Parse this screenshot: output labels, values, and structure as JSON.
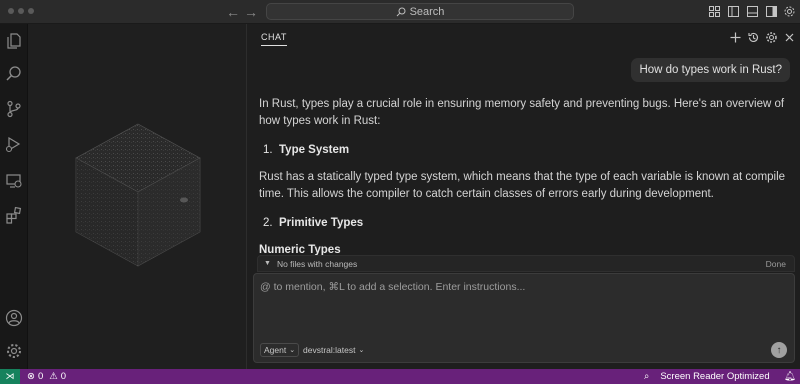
{
  "titlebar": {
    "search_label": "Search",
    "icons": [
      "back-arrow-icon",
      "forward-arrow-icon",
      "search-icon",
      "customize-layout-icon",
      "toggle-primary-sidebar-icon",
      "toggle-panel-icon",
      "toggle-secondary-sidebar-icon",
      "settings-gear-icon"
    ]
  },
  "activity_bar": {
    "items": [
      "explorer-icon",
      "search-icon",
      "source-control-icon",
      "run-debug-icon",
      "remote-explorer-icon",
      "extensions-icon"
    ],
    "bottom": [
      "accounts-icon",
      "manage-gear-icon"
    ]
  },
  "chat": {
    "tab_label": "CHAT",
    "header_icons": [
      "new-chat-icon",
      "history-icon",
      "settings-icon",
      "close-icon"
    ],
    "user_message": "How do types work in Rust?",
    "response": {
      "intro": "In Rust, types play a crucial role in ensuring memory safety and preventing bugs. Here's an overview of how types work in Rust:",
      "section1_num": "1.",
      "section1_title": "Type System",
      "section1_body": "Rust has a statically typed type system, which means that the type of each variable is known at compile time. This allows the compiler to catch certain classes of errors early during development.",
      "section2_num": "2.",
      "section2_title": "Primitive Types",
      "subheading": "Numeric Types"
    },
    "changes_label": "No files with changes",
    "done_label": "Done",
    "input_placeholder": "@ to mention, ⌘L to add a selection. Enter instructions...",
    "mode_label": "Agent",
    "model_label": "devstral:latest"
  },
  "statusbar": {
    "errors": "0",
    "warnings": "0",
    "screen_reader": "Screen Reader Optimized",
    "colors": {
      "bg": "#68217a",
      "remote": "#16825d"
    }
  }
}
